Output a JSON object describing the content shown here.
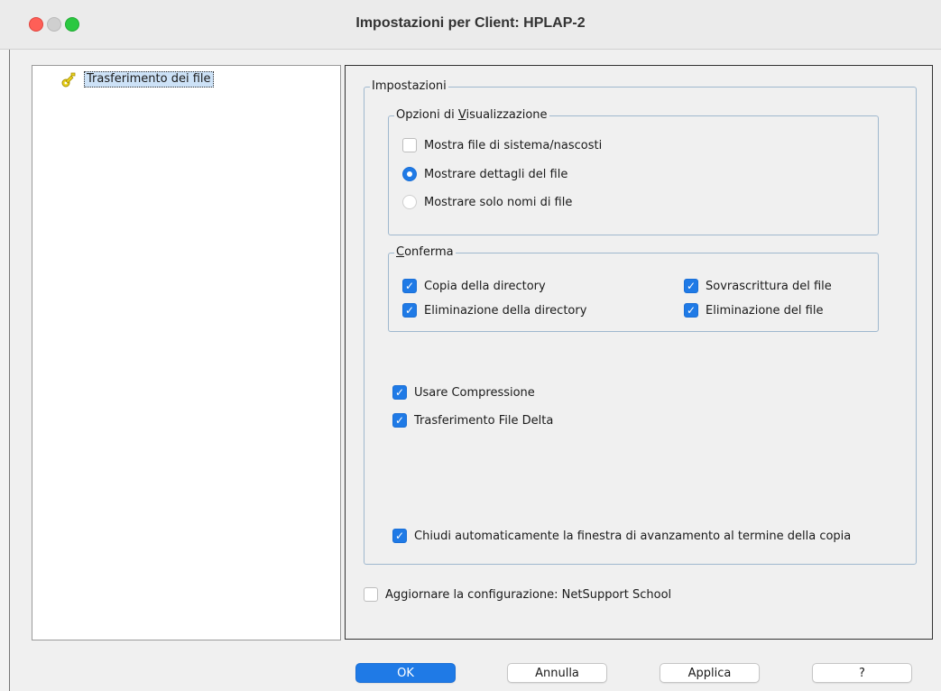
{
  "window": {
    "title": "Impostazioni per Client: HPLAP-2",
    "controls": [
      "close",
      "minimize",
      "zoom"
    ]
  },
  "tree": {
    "items": [
      {
        "label": "Trasferimento dei file",
        "icon": "key-icon",
        "selected": true
      }
    ]
  },
  "settings": {
    "group_label": "Impostazioni",
    "display_options": {
      "label_prefix": "Opzioni di ",
      "label_mnemonic": "V",
      "label_suffix": "isualizzazione",
      "show_hidden": {
        "label": "Mostra file di sistema/nascosti",
        "checked": false
      },
      "show_details": {
        "label": "Mostrare dettagli del file",
        "selected": true
      },
      "show_names": {
        "label": "Mostrare solo nomi di file",
        "selected": false
      }
    },
    "confirm": {
      "label_mnemonic": "C",
      "label_suffix": "onferma",
      "copy_dir": {
        "label": "Copia della directory",
        "checked": true
      },
      "delete_dir": {
        "label": "Eliminazione della directory",
        "checked": true
      },
      "overwrite_file": {
        "label": "Sovrascrittura del file",
        "checked": true
      },
      "delete_file": {
        "label": "Eliminazione del file",
        "checked": true
      }
    },
    "use_compression": {
      "label": "Usare Compressione",
      "checked": true
    },
    "delta_transfer": {
      "label": "Trasferimento File Delta",
      "checked": true
    },
    "auto_close": {
      "label": "Chiudi automaticamente la finestra di avanzamento al termine della copia",
      "checked": true
    }
  },
  "update_config": {
    "label": "Aggiornare la configurazione: NetSupport School",
    "checked": false
  },
  "buttons": {
    "ok": "OK",
    "cancel": "Annulla",
    "apply": "Applica",
    "help": "?"
  },
  "colors": {
    "accent": "#1f7ae6",
    "selection": "#cde2f7",
    "group_border": "#9fb8ce"
  }
}
